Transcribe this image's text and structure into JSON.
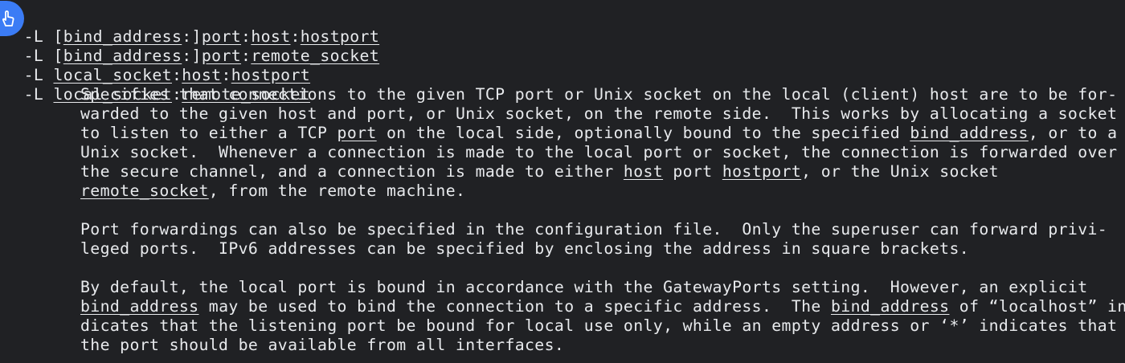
{
  "app": {
    "accent_color": "#3b7cf5",
    "background": "#202124",
    "text_color": "#e8eaed"
  },
  "fab": {
    "icon": "hand-pointer-icon"
  },
  "synopsis": [
    {
      "flag": "-L",
      "parts": [
        "[",
        "bind_address",
        ":]",
        "port",
        ":",
        "host",
        ":",
        "hostport"
      ]
    },
    {
      "flag": "-L",
      "parts": [
        "[",
        "bind_address",
        ":]",
        "port",
        ":",
        "remote_socket"
      ]
    },
    {
      "flag": "-L",
      "parts": [
        "",
        "local_socket",
        ":",
        "host",
        ":",
        "hostport"
      ]
    },
    {
      "flag": "-L",
      "parts": [
        "",
        "local_socket",
        ":",
        "remote_socket"
      ]
    }
  ],
  "description": [
    [
      "Specifies that connections to the given TCP port or Unix socket on the local (client) host are to be for-"
    ],
    [
      "warded to the given host and port, or Unix socket, on the remote side.  This works by allocating a socket"
    ],
    [
      "to listen to either a TCP ",
      "port",
      " on the local side, optionally bound to the specified ",
      "bind_address",
      ", or to a"
    ],
    [
      "Unix socket.  Whenever a connection is made to the local port or socket, the connection is forwarded over"
    ],
    [
      "the secure channel, and a connection is made to either ",
      "host",
      " port ",
      "hostport",
      ", or the Unix socket"
    ],
    [
      "",
      "remote_socket",
      ", from the remote machine."
    ],
    [
      ""
    ],
    [
      "Port forwardings can also be specified in the configuration file.  Only the superuser can forward privi-"
    ],
    [
      "leged ports.  IPv6 addresses can be specified by enclosing the address in square brackets."
    ],
    [
      ""
    ],
    [
      "By default, the local port is bound in accordance with the GatewayPorts setting.  However, an explicit"
    ],
    [
      "",
      "bind_address",
      " may be used to bind the connection to a specific address.  The ",
      "bind_address",
      " of “localhost” in-"
    ],
    [
      "dicates that the listening port be bound for local use only, while an empty address or ‘*’ indicates that"
    ],
    [
      "the port should be available from all interfaces."
    ]
  ]
}
